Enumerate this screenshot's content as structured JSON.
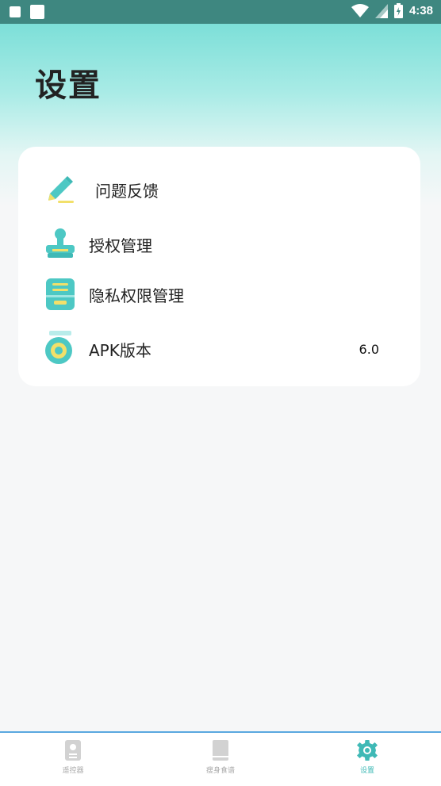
{
  "status_bar": {
    "time": "4:38"
  },
  "page": {
    "title": "设置"
  },
  "settings": {
    "items": [
      {
        "label": "问题反馈",
        "icon": "edit-pencil-icon"
      },
      {
        "label": "授权管理",
        "icon": "stamp-icon"
      },
      {
        "label": "隐私权限管理",
        "icon": "cabinet-icon"
      },
      {
        "label": "APK版本",
        "icon": "version-ring-icon",
        "value": "6.0"
      }
    ]
  },
  "bottom_nav": {
    "tabs": [
      {
        "label": "遥控器",
        "icon": "remote-icon",
        "active": false
      },
      {
        "label": "瘦身食谱",
        "icon": "book-icon",
        "active": false
      },
      {
        "label": "设置",
        "icon": "gear-icon",
        "active": true
      }
    ]
  },
  "colors": {
    "accent": "#3fb9b6",
    "status_bar": "#3e8780",
    "icon_yellow": "#f2e06a"
  }
}
